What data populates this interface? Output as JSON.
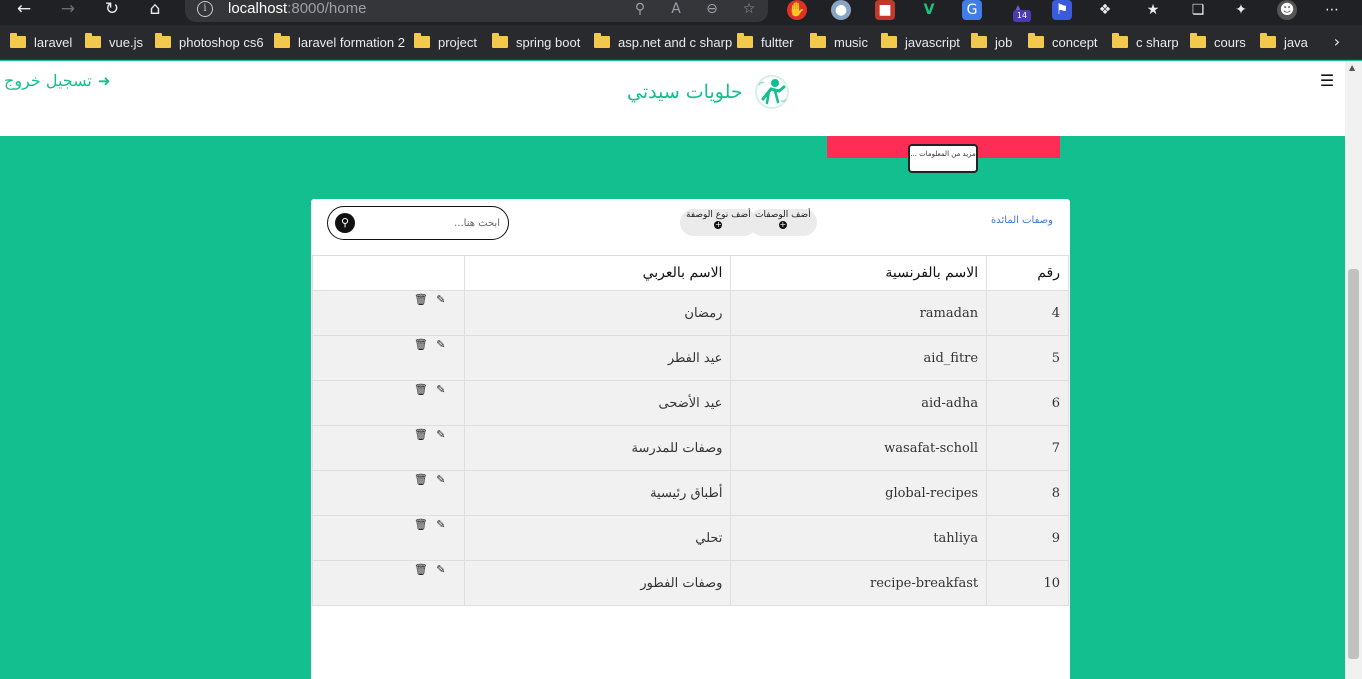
{
  "browser": {
    "url_host": "localhost",
    "url_rest": ":8000/home",
    "bookmarks": [
      "laravel",
      "vue.js",
      "photoshop cs6",
      "laravel formation 2",
      "project",
      "spring boot",
      "asp.net and c sharp",
      "fultter",
      "music",
      "javascript",
      "job",
      "concept",
      "c sharp",
      "cours",
      "java"
    ],
    "extension_badge": "14"
  },
  "header": {
    "logout_label": "تسجيل خروج",
    "brand_name": "حلويات سيدتي"
  },
  "promo": {
    "more_info_label": "مزيد من المعلومات ..."
  },
  "panel": {
    "recipes_link": "وصفات المائدة",
    "add_recipes_label": "أضف الوصفات",
    "add_recipe_type_label": "أضف نوع الوصفة",
    "search_placeholder": "ابحث هنا...",
    "columns": {
      "id": "رقم",
      "french_name": "الاسم بالفرنسية",
      "arabic_name": "الاسم بالعربي"
    },
    "rows": [
      {
        "id": "4",
        "fr": "ramadan",
        "ar": "رمضان"
      },
      {
        "id": "5",
        "fr": "aid_fitre",
        "ar": "عيد الفطر"
      },
      {
        "id": "6",
        "fr": "aid-adha",
        "ar": "عيد الأضحى"
      },
      {
        "id": "7",
        "fr": "wasafat-scholl",
        "ar": "وصفات للمدرسة"
      },
      {
        "id": "8",
        "fr": "global-recipes",
        "ar": "أطباق رئيسية"
      },
      {
        "id": "9",
        "fr": "tahliya",
        "ar": "تحلي"
      },
      {
        "id": "10",
        "fr": "recipe-breakfast",
        "ar": "وصفات الفطور"
      }
    ]
  },
  "icons": {
    "back": "back-arrow-icon",
    "forward": "forward-arrow-icon",
    "reload": "reload-icon",
    "home": "home-icon",
    "menu": "hamburger-menu-icon",
    "search": "search-icon",
    "edit": "pencil-icon",
    "delete": "trash-icon"
  },
  "colors": {
    "primary": "#14bf8f",
    "accent": "#ff2d55",
    "link": "#3a7bd5"
  }
}
